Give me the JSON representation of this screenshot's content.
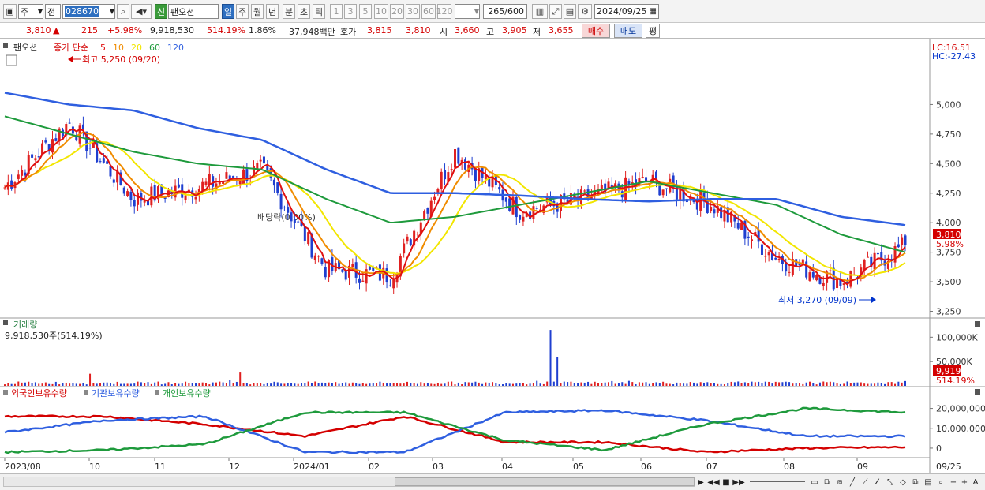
{
  "toolbar": {
    "market": "주",
    "sel2": "전",
    "code": "028670",
    "badge": "신",
    "name": "팬오션",
    "periods": [
      "일",
      "주",
      "월",
      "년",
      "분",
      "초",
      "틱"
    ],
    "intervals": [
      "1",
      "3",
      "5",
      "10",
      "20",
      "30",
      "60",
      "120"
    ],
    "count": "265",
    "count_max": "/600",
    "date": "2024/09/25"
  },
  "quote": {
    "price": "3,810",
    "arrow": "▲",
    "change": "215",
    "change_pct": "+5.98%",
    "volume": "9,918,530",
    "vol_ratio": "514.19%",
    "turnover": "1.86%",
    "amount": "37,948백만",
    "ask_label": "호가",
    "ask": "3,815",
    "bid": "3,810",
    "open_label": "시",
    "open": "3,660",
    "high_label": "고",
    "high": "3,905",
    "low_label": "저",
    "low": "3,655",
    "buy": "매수",
    "sell": "매도",
    "eval": "평"
  },
  "price_pane": {
    "title": "팬오션",
    "legend_label": "종가 단순",
    "ma": [
      {
        "period": "5",
        "color": "#e01010"
      },
      {
        "period": "10",
        "color": "#f08c00"
      },
      {
        "period": "20",
        "color": "#f2e600"
      },
      {
        "period": "60",
        "color": "#1e9a3c"
      },
      {
        "period": "120",
        "color": "#2f5fe0"
      }
    ],
    "max_note": "최고 5,250 (09/20)",
    "min_note": "최저 3,270 (09/09)",
    "dividend_note": "배당락(0.00%)",
    "lc": "LC:16.51",
    "hc": "HC:-27.43",
    "current": "3,810",
    "current_pct": "5.98%",
    "y_ticks": [
      "5,000",
      "4,750",
      "4,500",
      "4,250",
      "4,000",
      "3,750",
      "3,500",
      "3,250"
    ]
  },
  "volume_pane": {
    "title": "거래량",
    "value": "9,918,530주(514.19%)",
    "y_ticks": [
      "100,000K",
      "50,000K"
    ],
    "current": "9,919K",
    "current_pct": "514.19%"
  },
  "holdings_pane": {
    "series": [
      {
        "name": "외국인보유수량",
        "color": "#d40000"
      },
      {
        "name": "기관보유수량",
        "color": "#2f5fe0"
      },
      {
        "name": "개인보유수량",
        "color": "#1e9a3c"
      }
    ],
    "y_ticks": [
      "20,000,000",
      "10,000,000",
      "0"
    ]
  },
  "x_axis": {
    "labels": [
      "2023/08",
      "10",
      "11",
      "12",
      "2024/01",
      "02",
      "03",
      "04",
      "05",
      "06",
      "07",
      "08",
      "09"
    ],
    "right_label": "09/25"
  },
  "chart_data": [
    {
      "type": "line",
      "x": [
        "2023/08",
        "2023/09",
        "2023/10",
        "2023/11",
        "2023/12",
        "2024/01",
        "2024/02",
        "2024/03",
        "2024/04",
        "2024/05",
        "2024/06",
        "2024/07",
        "2024/08",
        "2024/09",
        "2024/09/25"
      ],
      "series": [
        {
          "name": "종가",
          "values": [
            4300,
            4850,
            4200,
            4300,
            4450,
            3600,
            3550,
            4600,
            4100,
            4200,
            4350,
            4150,
            3700,
            3500,
            3810
          ]
        },
        {
          "name": "60",
          "values": [
            4900,
            4750,
            4600,
            4500,
            4450,
            4200,
            4000,
            4050,
            4150,
            4250,
            4350,
            4250,
            4150,
            3900,
            3750
          ]
        },
        {
          "name": "120",
          "values": [
            5100,
            5000,
            4950,
            4800,
            4700,
            4450,
            4250,
            4250,
            4230,
            4200,
            4180,
            4200,
            4200,
            4050,
            3980
          ]
        }
      ],
      "ylim": [
        3200,
        5250
      ]
    },
    {
      "type": "bar",
      "title": "거래량",
      "x": [
        "2023/08",
        "2023/09",
        "2023/10",
        "2023/11",
        "2023/12",
        "2024/01",
        "2024/02",
        "2024/03",
        "2024/04",
        "2024/05",
        "2024/06",
        "2024/07",
        "2024/08",
        "2024/09",
        "2024/09/25"
      ],
      "values": [
        5000,
        30000,
        8000,
        6000,
        35000,
        10000,
        115000,
        20000,
        8000,
        18000,
        10000,
        8000,
        12000,
        9000,
        9919
      ]
    },
    {
      "type": "line",
      "x": [
        "2023/08",
        "2023/10",
        "2023/12",
        "2024/01",
        "2024/02",
        "2024/03",
        "2024/05",
        "2024/07",
        "2024/09",
        "2024/09/25"
      ],
      "series": [
        {
          "name": "외국인보유수량",
          "values": [
            16000000,
            16000000,
            12000000,
            6000000,
            16000000,
            3000000,
            3000000,
            -2000000,
            0,
            500000
          ]
        },
        {
          "name": "기관보유수량",
          "values": [
            8000000,
            14000000,
            16000000,
            -2000000,
            -2000000,
            18000000,
            19000000,
            14000000,
            6000000,
            6000000
          ]
        },
        {
          "name": "개인보유수량",
          "values": [
            -2000000,
            -1000000,
            2000000,
            18000000,
            18000000,
            4000000,
            -1000000,
            12000000,
            20000000,
            18000000
          ]
        }
      ]
    }
  ]
}
